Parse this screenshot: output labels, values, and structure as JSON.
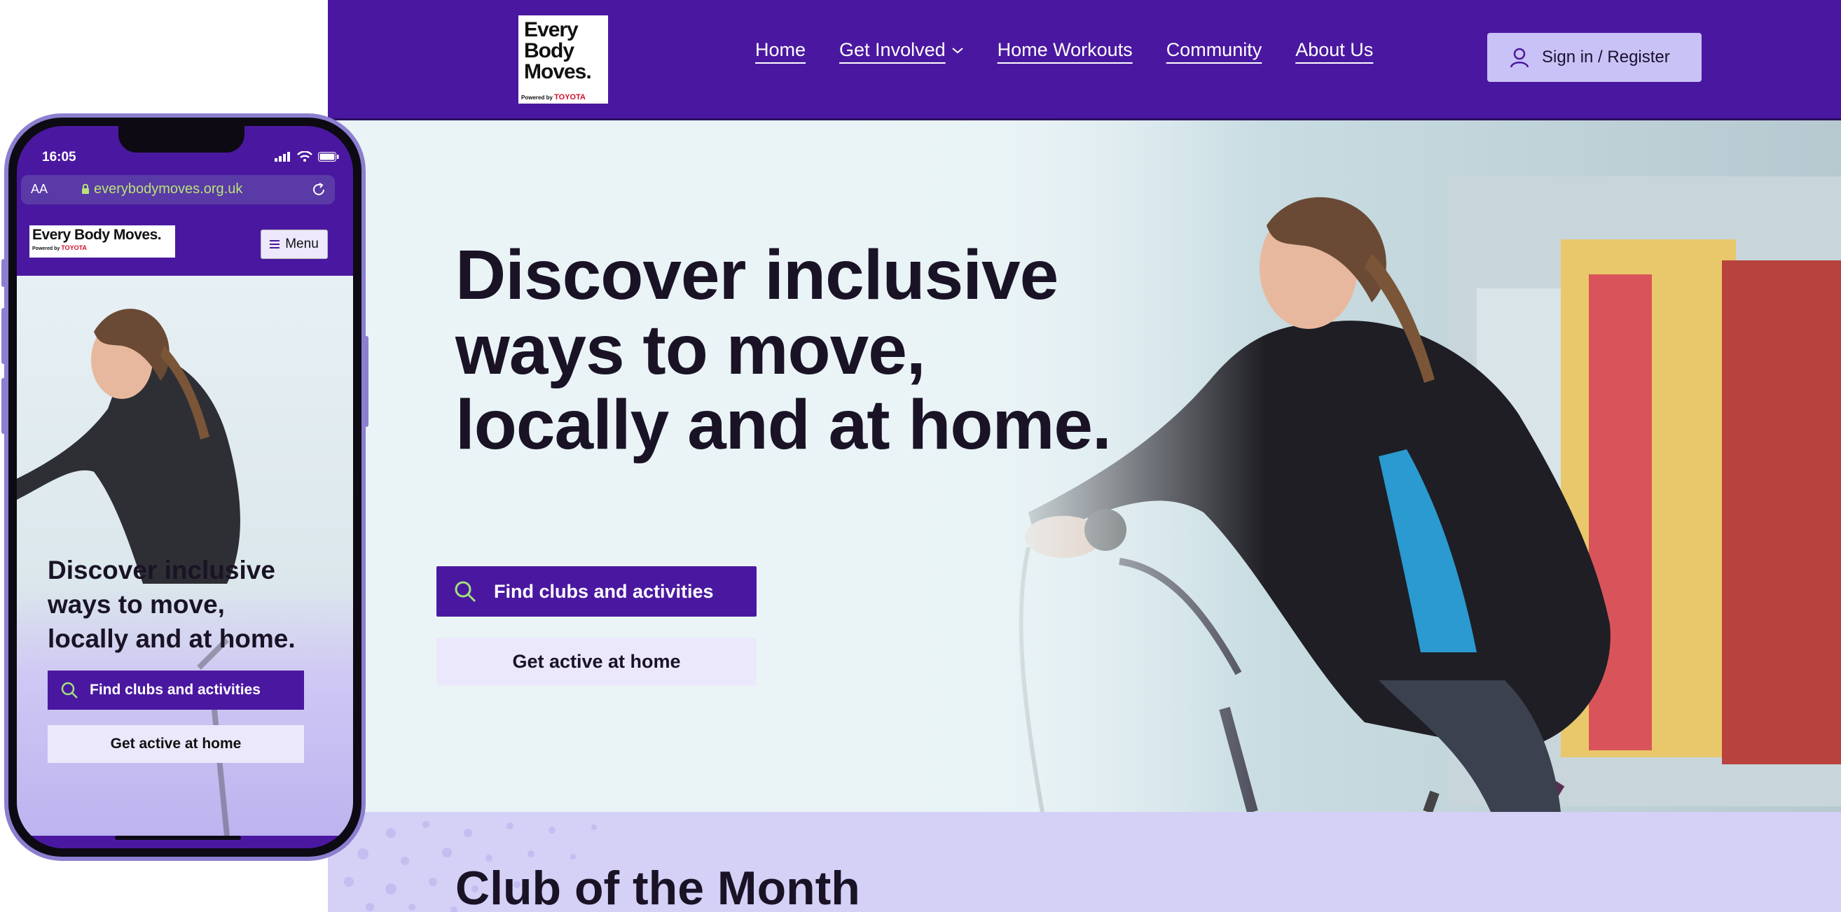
{
  "desktop": {
    "logo": {
      "line1": "Every",
      "line2": "Body",
      "line3": "Moves.",
      "powered_by": "Powered by",
      "brand": "TOYOTA"
    },
    "nav": [
      {
        "label": "Home"
      },
      {
        "label": "Get Involved",
        "has_dropdown": true
      },
      {
        "label": "Home Workouts"
      },
      {
        "label": "Community"
      },
      {
        "label": "About Us"
      }
    ],
    "signin_label": "Sign in / Register",
    "hero": {
      "title_line1": "Discover inclusive",
      "title_line2": "ways to move,",
      "title_line3": "locally and at home.",
      "find_button": "Find clubs and activities",
      "home_button": "Get active at home"
    },
    "section_title": "Club of the Month"
  },
  "mobile": {
    "status": {
      "time": "16:05"
    },
    "browser": {
      "text_size": "AA",
      "url": "everybodymoves.org.uk"
    },
    "logo": {
      "line1": "Every Body Moves.",
      "powered_by": "Powered by",
      "brand": "TOYOTA"
    },
    "menu_label": "Menu",
    "hero": {
      "title_line1": "Discover inclusive",
      "title_line2": "ways to move,",
      "title_line3": "locally and at home.",
      "find_button": "Find clubs and activities",
      "home_button": "Get active at home"
    }
  },
  "colors": {
    "brand_purple": "#4a18a0",
    "lavender": "#d5d0f6",
    "light_button": "#ece8fb",
    "signin_bg": "#c9c2f6",
    "ink": "#1a1326",
    "toyota_red": "#d0102a"
  },
  "icons": [
    "search-icon",
    "user-icon",
    "chevron-down-icon",
    "lock-icon",
    "reload-icon",
    "signal-icon",
    "wifi-icon",
    "battery-icon",
    "hamburger-icon"
  ]
}
